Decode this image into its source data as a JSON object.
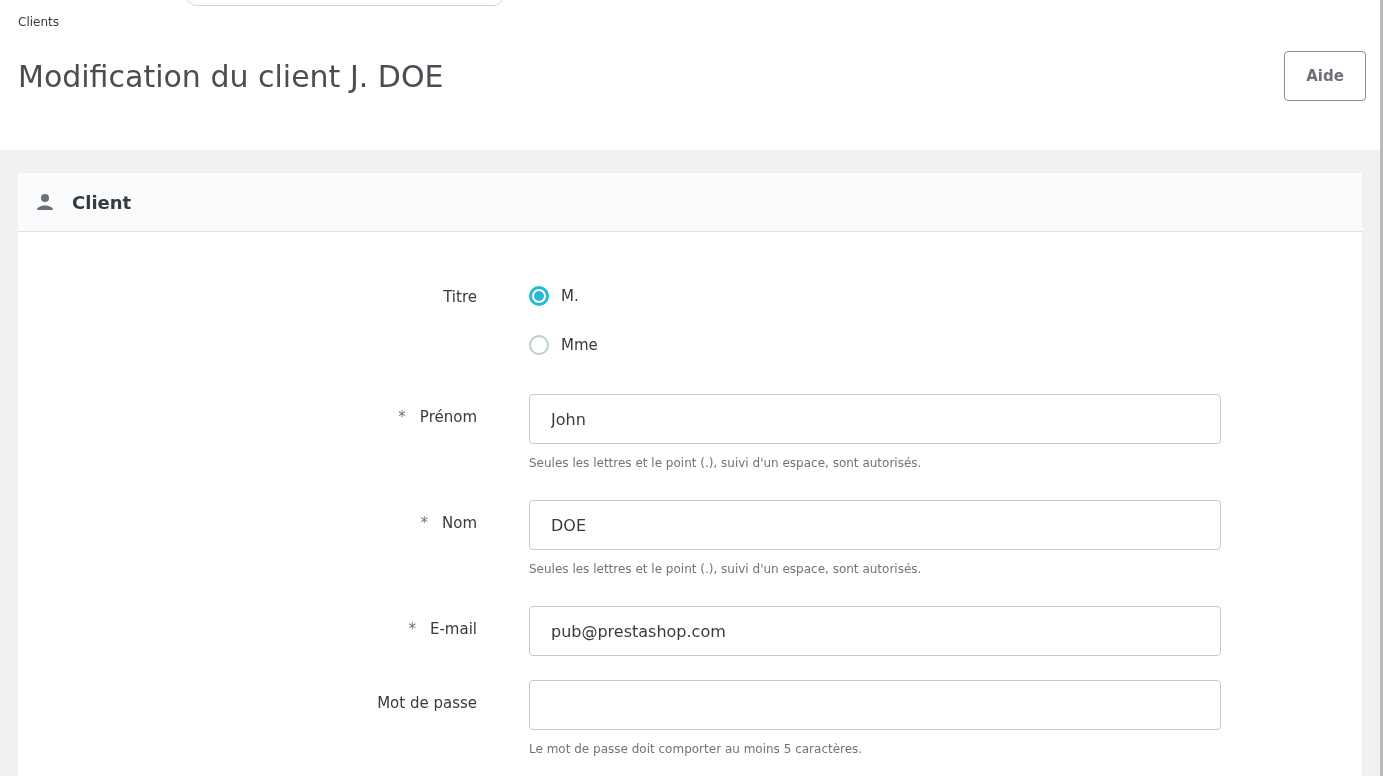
{
  "breadcrumb": "Clients",
  "page_title": "Modification du client J. DOE",
  "help_button": "Aide",
  "panel": {
    "title": "Client",
    "fields": [
      {
        "kind": "radio",
        "label": "Titre",
        "options": [
          {
            "label": "M.",
            "selected": true
          },
          {
            "label": "Mme",
            "selected": false
          }
        ]
      },
      {
        "kind": "text",
        "required_mark": "*",
        "label": "Prénom",
        "value": "John",
        "help": "Seules les lettres et le point (.), suivi d'un espace, sont autorisés."
      },
      {
        "kind": "text",
        "required_mark": "*",
        "label": "Nom",
        "value": "DOE",
        "help": "Seules les lettres et le point (.), suivi d'un espace, sont autorisés."
      },
      {
        "kind": "text",
        "required_mark": "*",
        "label": "E-mail",
        "value": "pub@prestashop.com"
      },
      {
        "kind": "password",
        "label": "Mot de passe",
        "help": "Le mot de passe doit comporter au moins 5 caractères."
      }
    ]
  }
}
